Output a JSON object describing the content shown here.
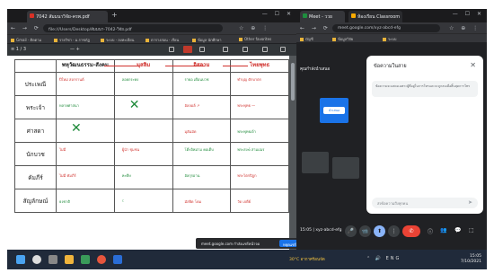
{
  "left_browser": {
    "tabs": [
      "7042 สัมมนาวิจัย-ครพ.pdf"
    ],
    "tab_add": "+",
    "window_controls": "— ☐ ✕",
    "url": "file:///Users/Desktop/สัมมนา-7042-วิจัย.pdf",
    "bookmarks": [
      "Gmail · ติดตาม",
      "รายวิชา · ม.ราชภัฏ",
      "ระบบ · ลงทะเบียน",
      "ตารางสอน · เรียน",
      "ข้อมูล นักศึกษา",
      "Other favorites"
    ],
    "pdf_toolbar": {
      "page_label": "≡  1 / 3",
      "zoom": "—  +"
    },
    "table": {
      "headers": [
        "",
        "พหุวัฒนธรรม-สังคม",
        "มุสลิม",
        "อิสลาม",
        "ไทยพุทธ"
      ],
      "rows": [
        {
          "label": "ประเพณี",
          "notes": [
            "ปีใหม่ สงกรานต์",
            "ลอยกระทง",
            "รายอ เดือนบวช",
            "ทำบุญ ตักบาตร"
          ]
        },
        {
          "label": "พระเจ้า",
          "notes": [
            "หลายศาสนา",
            "✕",
            "อัลลอฮ์ ↗",
            "พระพุทธ —"
          ]
        },
        {
          "label": "ศาสดา",
          "notes": [
            "✕",
            "",
            "มุฮัมมัด",
            "พระพุทธเจ้า"
          ]
        },
        {
          "label": "นักบวช",
          "notes": [
            "ไม่มี",
            "ผู้นำ ชุมชน",
            "โต๊ะอิหม่าม คอเต็บ",
            "พระสงฆ์ สามเณร"
          ]
        },
        {
          "label": "คัมภีร์",
          "notes": [
            "ไม่มี คัมภีร์",
            "หะดีษ",
            "อัลกุรอาน",
            "พระไตรปิฎก"
          ]
        },
        {
          "label": "สัญลักษณ์",
          "notes": [
            "ธงชาติ",
            "☾",
            "มัสยิด โดม",
            "วัด เจดีย์"
          ]
        }
      ]
    },
    "download_bar": {
      "text": "meet.google.com กำลังแชร์หน้าจอ",
      "button": "หยุดแชร์"
    }
  },
  "right_browser": {
    "tabs": [
      "Meet - ววย",
      "ห้องเรียน Classroom"
    ],
    "url": "meet.google.com/xyz-abcd-efg",
    "bookmarks": [
      "บัญชี",
      "ข้อมูลวิจัย",
      "ระบบ"
    ],
    "stage_label": "คุณกำลังนำเสนอ",
    "presenter_tile": "นำเสนอ",
    "chat": {
      "title": "ข้อความในสาย",
      "close": "✕",
      "info": "ข้อความจะแสดงเฉพาะผู้ที่อยู่ในการโทรและจะถูกลบเมื่อสิ้นสุดการโทร",
      "input_placeholder": "ส่งข้อความถึงทุกคน",
      "send": "➤"
    },
    "meeting_time": "15:05 | xyz-abcd-efg",
    "controls": [
      "🎤",
      "📹",
      "⬆",
      "⋮",
      "✆"
    ],
    "side_icons": [
      "ⓘ",
      "👥",
      "💬",
      "⬚"
    ]
  },
  "taskbar": {
    "news": "30°C อากาศร้อนจัด",
    "tray": "⌃ 🔊 ENG",
    "clock_time": "15:05",
    "clock_date": "7/10/2021"
  },
  "colors": {
    "accent_blue": "#1a73e8",
    "end_call_red": "#ea4335",
    "annotation_red": "#d0312d",
    "annotation_green": "#1e8a3a"
  }
}
